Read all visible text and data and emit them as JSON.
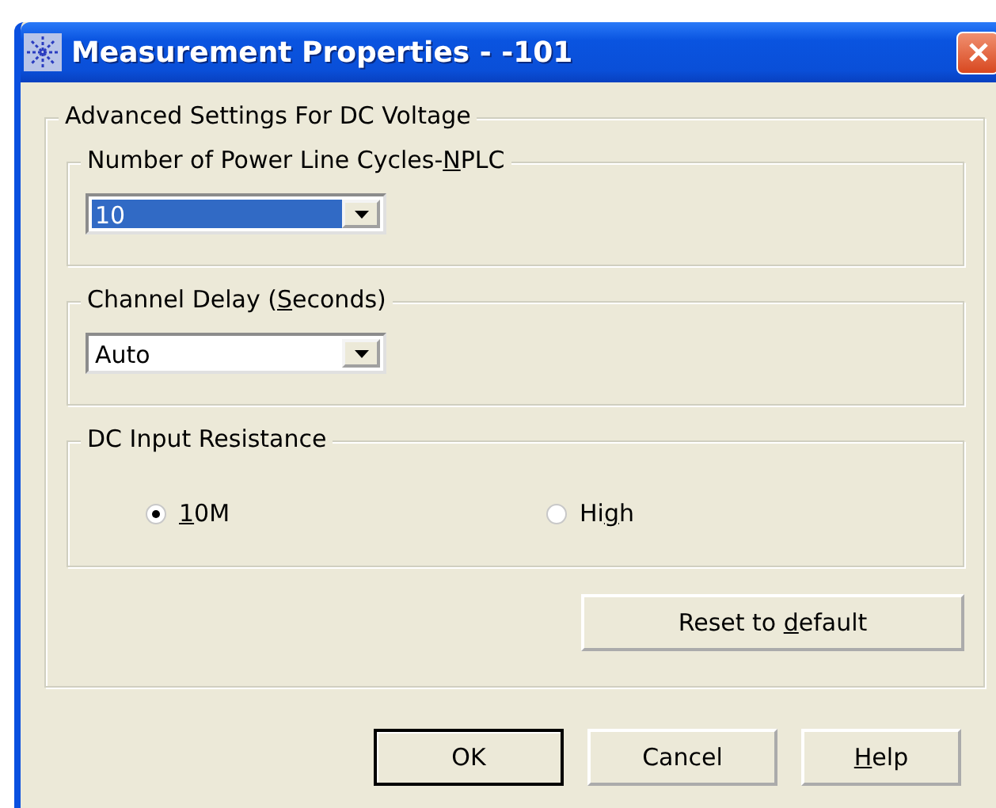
{
  "window": {
    "title": "Measurement Properties - -101"
  },
  "group": {
    "title": "Advanced Settings For DC Voltage",
    "sections": [
      {
        "kind": "combo",
        "label": {
          "before": "Number of Power Line Cycles-",
          "key": "N",
          "after": "PLC"
        },
        "value": "10",
        "focused": true
      },
      {
        "kind": "combo",
        "label": {
          "before": "Channel Delay (",
          "key": "S",
          "after": "econds)"
        },
        "value": "Auto",
        "focused": false
      },
      {
        "kind": "radios",
        "label": {
          "before": "DC Input Resistance"
        },
        "options": [
          {
            "label": {
              "key": "1",
              "after": "0M"
            },
            "selected": true
          },
          {
            "label": {
              "before": "Hi",
              "key": "g",
              "after": "h"
            },
            "selected": false
          }
        ]
      }
    ]
  },
  "reset_button": {
    "before": "Reset to ",
    "key": "d",
    "after": "efault"
  },
  "buttons": [
    {
      "label": {
        "before": "OK"
      },
      "default": true
    },
    {
      "label": {
        "before": "Cancel"
      },
      "default": false
    },
    {
      "label": {
        "key": "H",
        "after": "elp"
      },
      "default": false
    }
  ]
}
